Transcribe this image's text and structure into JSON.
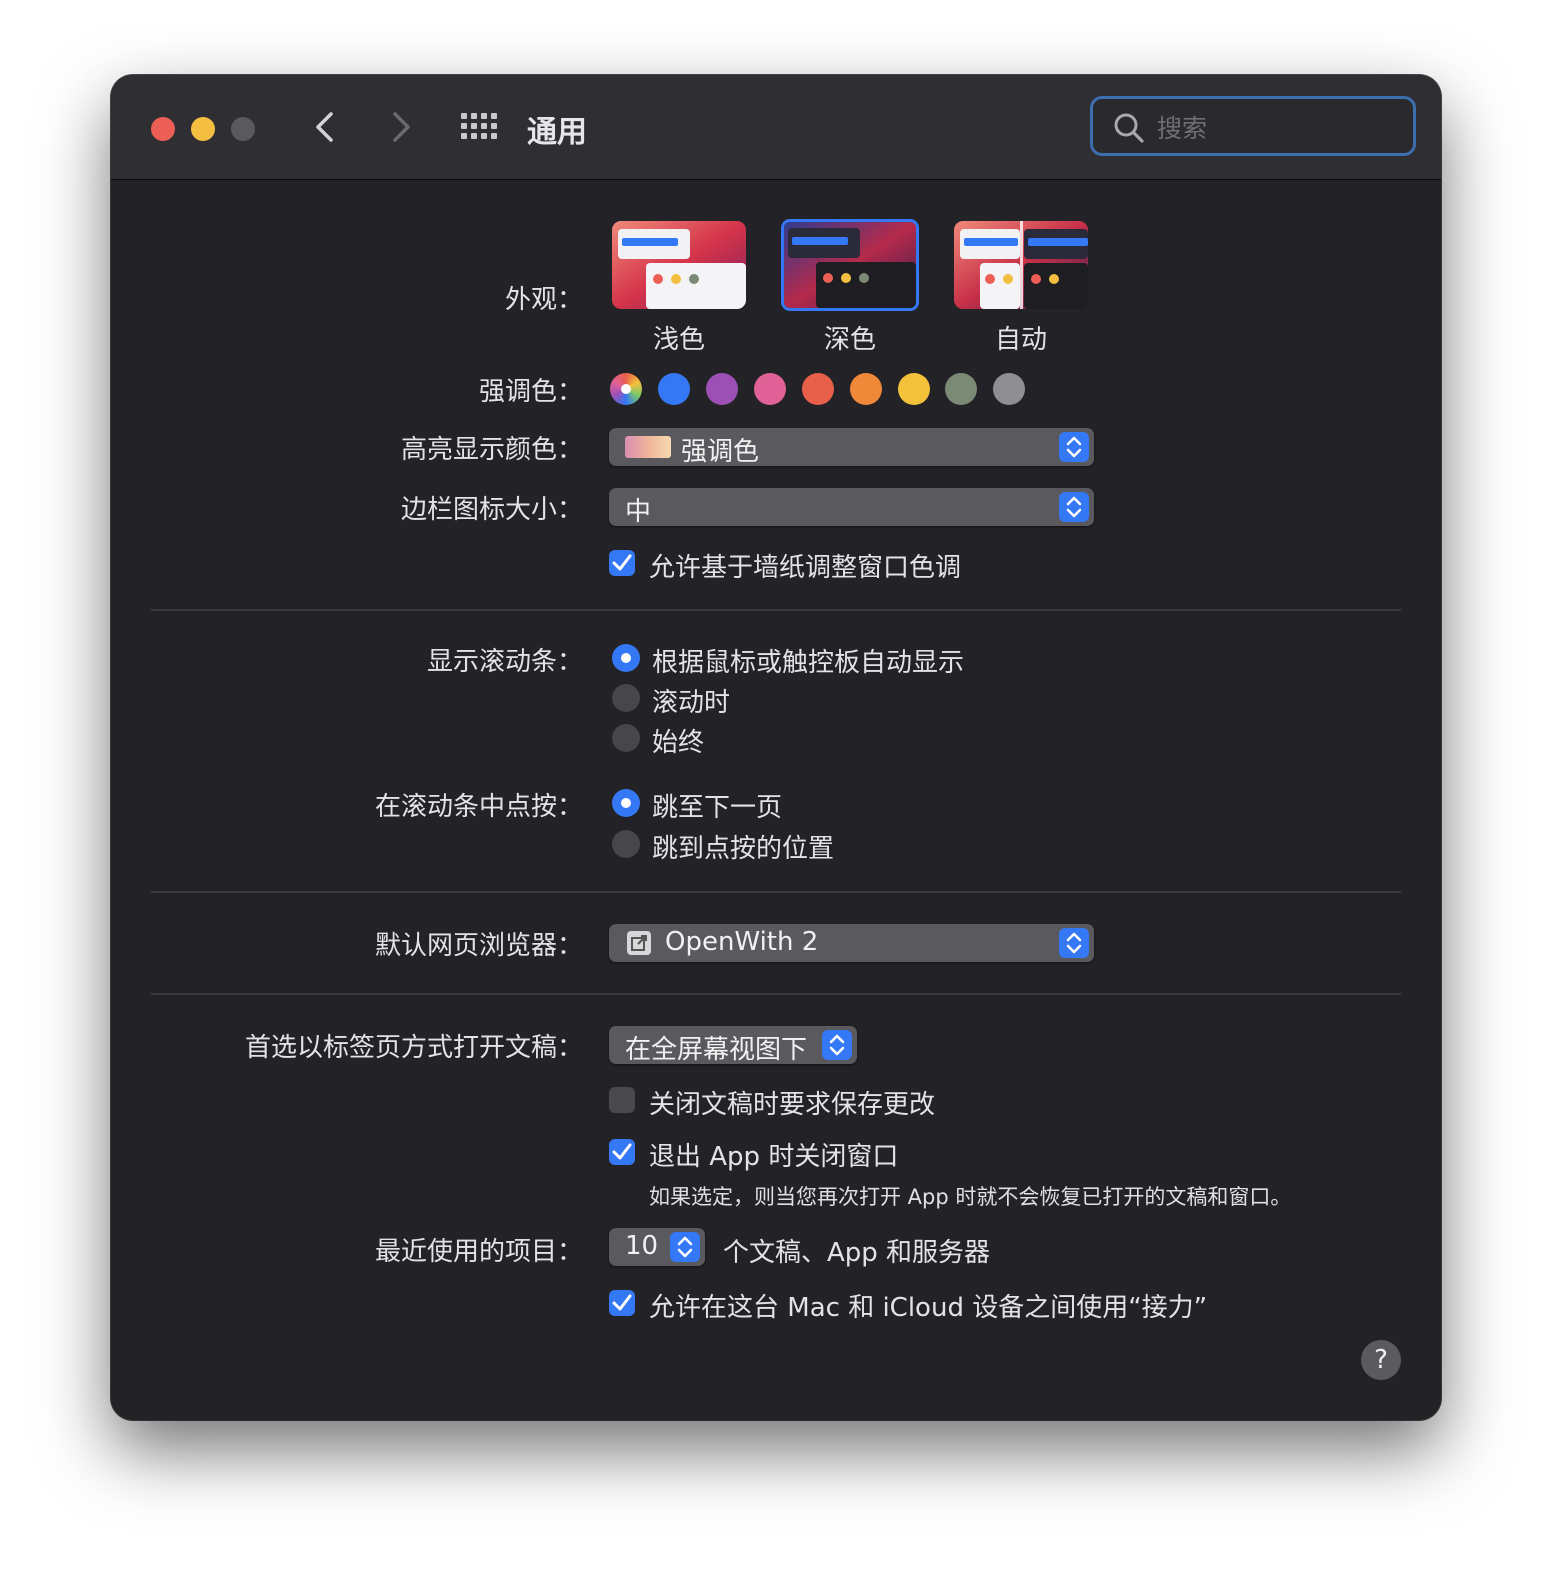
{
  "window": {
    "title": "通用",
    "search": {
      "placeholder": "搜索"
    }
  },
  "appearance": {
    "label": "外观：",
    "options": [
      {
        "label": "浅色",
        "selected": false
      },
      {
        "label": "深色",
        "selected": true
      },
      {
        "label": "自动",
        "selected": false
      }
    ]
  },
  "accent": {
    "label": "强调色：",
    "colors": [
      "multicolor",
      "#3478f6",
      "#9c50b6",
      "#e06296",
      "#e9604a",
      "#f0883a",
      "#f4c13a",
      "#7b8a74",
      "#8e8e93"
    ],
    "selected_index": 0
  },
  "highlight": {
    "label": "高亮显示颜色：",
    "value": "强调色"
  },
  "sidebar_icon_size": {
    "label": "边栏图标大小：",
    "value": "中"
  },
  "wallpaper_tint": {
    "label": "允许基于墙纸调整窗口色调",
    "checked": true
  },
  "scrollbars": {
    "label": "显示滚动条：",
    "options": [
      {
        "label": "根据鼠标或触控板自动显示",
        "selected": true
      },
      {
        "label": "滚动时",
        "selected": false
      },
      {
        "label": "始终",
        "selected": false
      }
    ]
  },
  "scroll_click": {
    "label": "在滚动条中点按：",
    "options": [
      {
        "label": "跳至下一页",
        "selected": true
      },
      {
        "label": "跳到点按的位置",
        "selected": false
      }
    ]
  },
  "browser": {
    "label": "默认网页浏览器：",
    "value": "OpenWith 2"
  },
  "tabs": {
    "label": "首选以标签页方式打开文稿：",
    "value": "在全屏幕视图下"
  },
  "ask_save": {
    "label": "关闭文稿时要求保存更改",
    "checked": false
  },
  "close_windows": {
    "label": "退出 App 时关闭窗口",
    "checked": true,
    "note": "如果选定，则当您再次打开 App 时就不会恢复已打开的文稿和窗口。"
  },
  "recent": {
    "label": "最近使用的项目：",
    "value": "10",
    "suffix": "个文稿、App 和服务器"
  },
  "handoff": {
    "label": "允许在这台 Mac 和 iCloud 设备之间使用“接力”",
    "checked": true
  },
  "help": {
    "label": "?"
  },
  "colors": {
    "accent": "#3478f6",
    "window_bg": "#232226",
    "titlebar_bg": "#2f2e33"
  }
}
